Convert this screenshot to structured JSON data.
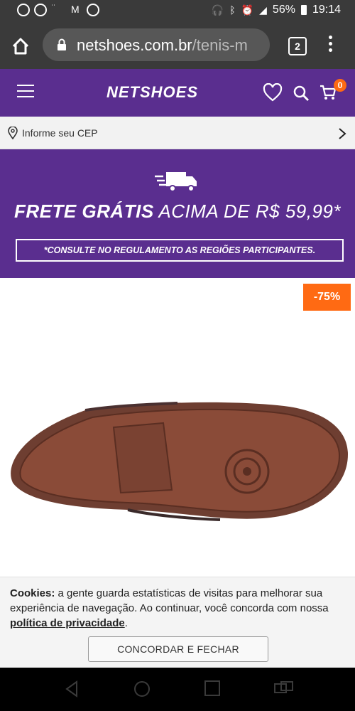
{
  "status_bar": {
    "battery": "56%",
    "time": "19:14"
  },
  "browser": {
    "domain": "netshoes.com.br",
    "path": "/tenis-m",
    "tab_count": "2"
  },
  "site_header": {
    "logo": "NETSHOES",
    "cart_count": "0"
  },
  "cep_bar": {
    "label": "Informe seu CEP"
  },
  "promo": {
    "title_bold": "FRETE GRÁTIS",
    "title_rest": "ACIMA DE R$ 59,99*",
    "note": "*CONSULTE NO REGULAMENTO AS REGIÕES PARTICIPANTES."
  },
  "product": {
    "discount": "-75%"
  },
  "cookie": {
    "label": "Cookies:",
    "text": "a gente guarda estatísticas de visitas para melhorar sua experiência de navegação. Ao continuar, você concorda com nossa",
    "link": "política de privacidade",
    "end": ".",
    "button": "CONCORDAR E FECHAR"
  },
  "colors": {
    "brand_purple": "#5a2e8f",
    "accent_orange": "#ff6a13",
    "chrome_dark": "#3a3a3a"
  }
}
